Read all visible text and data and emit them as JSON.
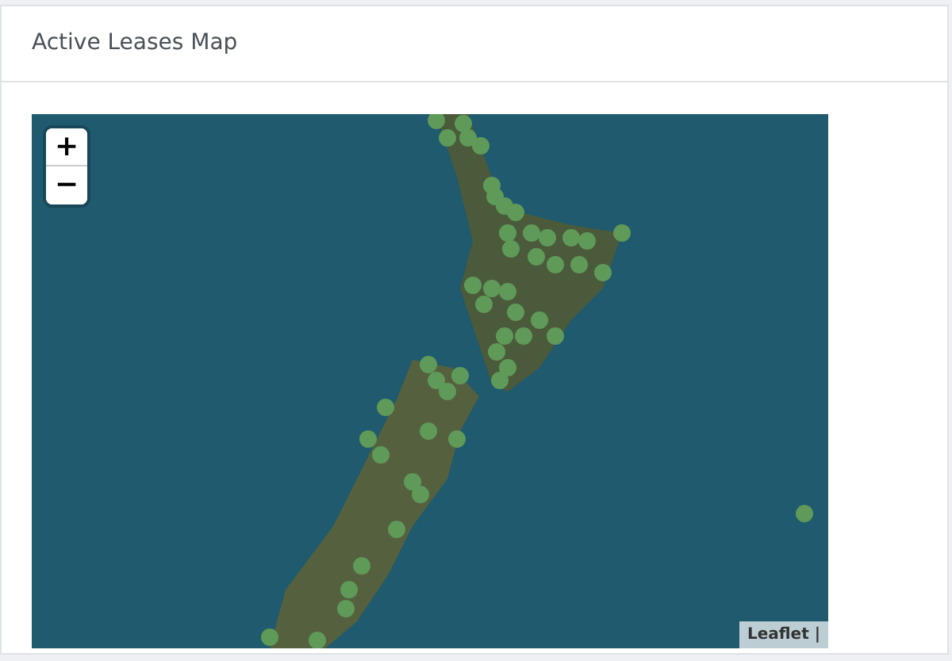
{
  "card": {
    "title": "Active Leases Map"
  },
  "map": {
    "zoom_in": "+",
    "zoom_out": "−",
    "attribution": "Leaflet |"
  }
}
